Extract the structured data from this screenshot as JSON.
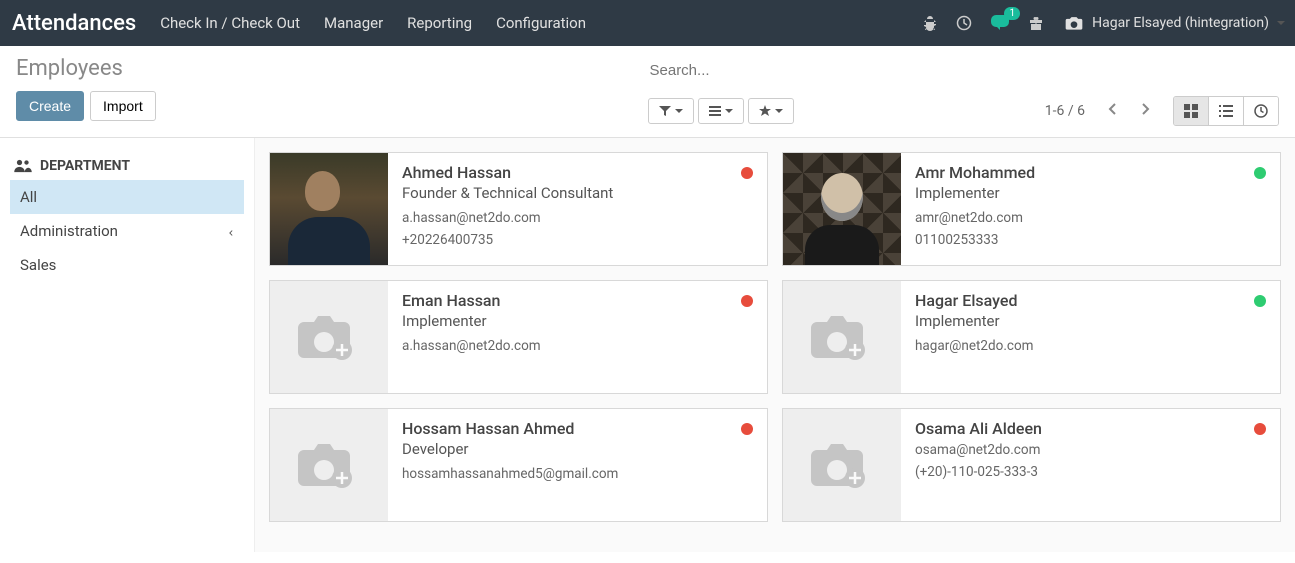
{
  "navbar": {
    "brand": "Attendances",
    "links": [
      "Check In / Check Out",
      "Manager",
      "Reporting",
      "Configuration"
    ],
    "chat_badge": "1",
    "user": "Hagar Elsayed (hintegration)"
  },
  "control": {
    "breadcrumb": "Employees",
    "create_label": "Create",
    "import_label": "Import",
    "search_placeholder": "Search...",
    "pager": "1-6 / 6"
  },
  "sidebar": {
    "header": "DEPARTMENT",
    "items": [
      {
        "label": "All",
        "active": true,
        "has_children": false
      },
      {
        "label": "Administration",
        "active": false,
        "has_children": true
      },
      {
        "label": "Sales",
        "active": false,
        "has_children": false
      }
    ]
  },
  "employees": [
    {
      "name": "Ahmed Hassan",
      "title": "Founder & Technical Consultant",
      "email": "a.hassan@net2do.com",
      "phone": "+20226400735",
      "status": "red",
      "photo": "photo1"
    },
    {
      "name": "Amr Mohammed",
      "title": "Implementer",
      "email": "amr@net2do.com",
      "phone": "01100253333",
      "status": "green",
      "photo": "photo2"
    },
    {
      "name": "Eman Hassan",
      "title": "Implementer",
      "email": "a.hassan@net2do.com",
      "phone": "",
      "status": "red",
      "photo": ""
    },
    {
      "name": "Hagar Elsayed",
      "title": "Implementer",
      "email": "hagar@net2do.com",
      "phone": "",
      "status": "green",
      "photo": ""
    },
    {
      "name": "Hossam Hassan Ahmed",
      "title": "Developer",
      "email": "hossamhassanahmed5@gmail.com",
      "phone": "",
      "status": "red",
      "photo": ""
    },
    {
      "name": "Osama Ali Aldeen",
      "title": "",
      "email": "osama@net2do.com",
      "phone": "(+20)-110-025-333-3",
      "status": "red",
      "photo": ""
    }
  ]
}
